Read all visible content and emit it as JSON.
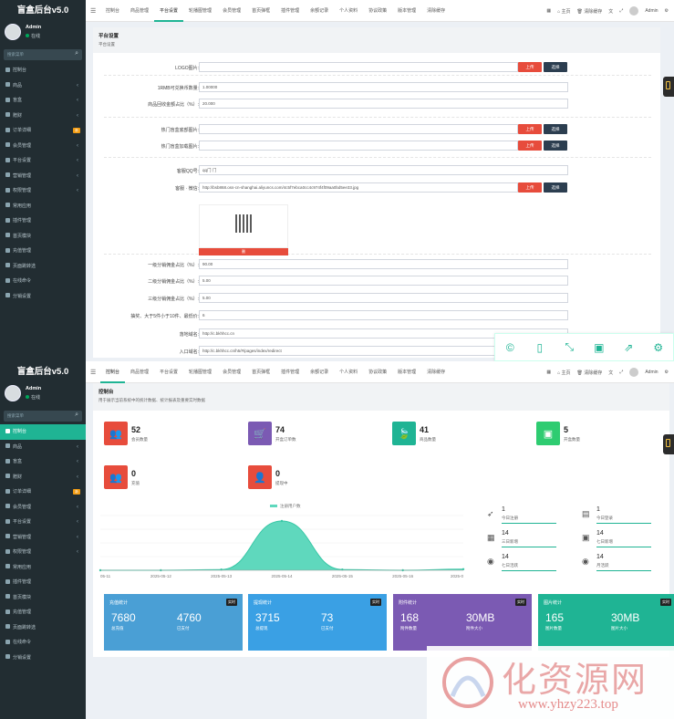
{
  "brand": "盲盒后台v5.0",
  "user": {
    "name": "Admin",
    "status": "在线"
  },
  "sidebar": {
    "search_placeholder": "搜索菜单",
    "items": [
      {
        "label": "控制台"
      },
      {
        "label": "商品"
      },
      {
        "label": "盲盒"
      },
      {
        "label": "赠财"
      },
      {
        "label": "订单详细",
        "badge": "新"
      },
      {
        "label": "会员管理"
      },
      {
        "label": "平台设置"
      },
      {
        "label": "营销管理"
      },
      {
        "label": "权限管理"
      },
      {
        "label": "常用应用"
      },
      {
        "label": "插件管理"
      },
      {
        "label": "首页模块"
      },
      {
        "label": "充值管理"
      },
      {
        "label": "页面跳转选"
      },
      {
        "label": "在线命令"
      },
      {
        "label": "分销设置"
      }
    ]
  },
  "topbar": {
    "tabs": [
      "控制台",
      "商品管理",
      "平台设置",
      "轮播图管理",
      "会员管理",
      "首页弹框",
      "插件管理",
      "余额记录",
      "个人资料",
      "协议政策",
      "版本管理",
      "清除缓存"
    ],
    "home": "主页",
    "clear": "清除缓存",
    "admin": "Admin"
  },
  "settings": {
    "title": "平台设置",
    "subtitle": "平台设置",
    "fields": [
      {
        "label": "LOGO图片:",
        "value": ""
      },
      {
        "label": "1RMB可兑换币数量:",
        "value": "1.00000"
      },
      {
        "label": "商品回收金额占比（%）:",
        "value": "20.000"
      },
      {
        "label": "热门盲盒底部图片:",
        "value": ""
      },
      {
        "label": "热门盲盒加载图片:",
        "value": ""
      },
      {
        "label": "客服QQ号:",
        "value": "qq门 门"
      },
      {
        "label": "客服 · 微信:",
        "value": "http://bsb868.oss-cn-shanghai.aliyuncs.com/4c5f7ebca0cc4c974f4f09aa0bd5ee33.jpg"
      },
      {
        "label": "一级分销佣金占比（%）:",
        "value": "90.00"
      },
      {
        "label": "二级分销佣金占比（%）:",
        "value": "5.00"
      },
      {
        "label": "三级分销佣金占比（%）:",
        "value": "5.00"
      },
      {
        "label": "抽奖、大于5件小于10件、最低价:",
        "value": "6"
      },
      {
        "label": "落地域名:",
        "value": "http://c.bkhhcc.cn"
      },
      {
        "label": "入口域名:",
        "value": "http://c.bkhhcc.cn/h5/#/pages/index/redirect"
      }
    ],
    "upload": "上传",
    "choose": "选择",
    "delete": "删"
  },
  "dashboard": {
    "title": "控制台",
    "subtitle": "用于展示当前系统中的统计数据、统计报表及重要实时数据",
    "stats": [
      {
        "value": "52",
        "label": "会员数量",
        "color": "#e74c3c"
      },
      {
        "value": "74",
        "label": "开盒订单数",
        "color": "#7b5ab3"
      },
      {
        "value": "41",
        "label": "商品数量",
        "color": "#1fb494"
      },
      {
        "value": "5",
        "label": "开盒数量",
        "color": "#2ecc71"
      },
      {
        "value": "0",
        "label": "充值",
        "color": "#e74c3c"
      },
      {
        "value": "0",
        "label": "提现中",
        "color": "#e74c3c"
      }
    ],
    "chart_legend": "注册用户数",
    "mini_stats": [
      {
        "value": "1",
        "label": "今日注册"
      },
      {
        "value": "1",
        "label": "今日登录"
      },
      {
        "value": "14",
        "label": "三日新增"
      },
      {
        "value": "14",
        "label": "七日新增"
      },
      {
        "value": "14",
        "label": "七日活跃"
      },
      {
        "value": "14",
        "label": "月活跃"
      }
    ],
    "panels": [
      {
        "title": "充值统计",
        "badge": "实时",
        "v1": "7680",
        "l1": "总充值",
        "v2": "4760",
        "l2": "已支付",
        "color": "#4a9fd5"
      },
      {
        "title": "提现统计",
        "badge": "实时",
        "v1": "3715",
        "l1": "总提现",
        "v2": "73",
        "l2": "已支付",
        "color": "#3aa0e4"
      },
      {
        "title": "附件统计",
        "badge": "实时",
        "v1": "168",
        "l1": "附件数量",
        "v2": "30MB",
        "l2": "附件大小",
        "color": "#7b5ab3"
      },
      {
        "title": "图片统计",
        "badge": "实时",
        "v1": "165",
        "l1": "图片数量",
        "v2": "30MB",
        "l2": "图片大小",
        "color": "#1fb494"
      }
    ]
  },
  "chart_data": {
    "type": "area",
    "x": [
      "05-11",
      "2025-05-12",
      "2025-05-13",
      "2025-05-14",
      "2025-05-15",
      "2025-05-16",
      "2025-0"
    ],
    "series": [
      {
        "name": "注册用户数",
        "values": [
          0,
          0,
          0.2,
          13.5,
          0.2,
          0,
          0.3
        ]
      }
    ]
  },
  "watermark": {
    "text": "化资源网",
    "url": "www.yhzy223.top"
  }
}
